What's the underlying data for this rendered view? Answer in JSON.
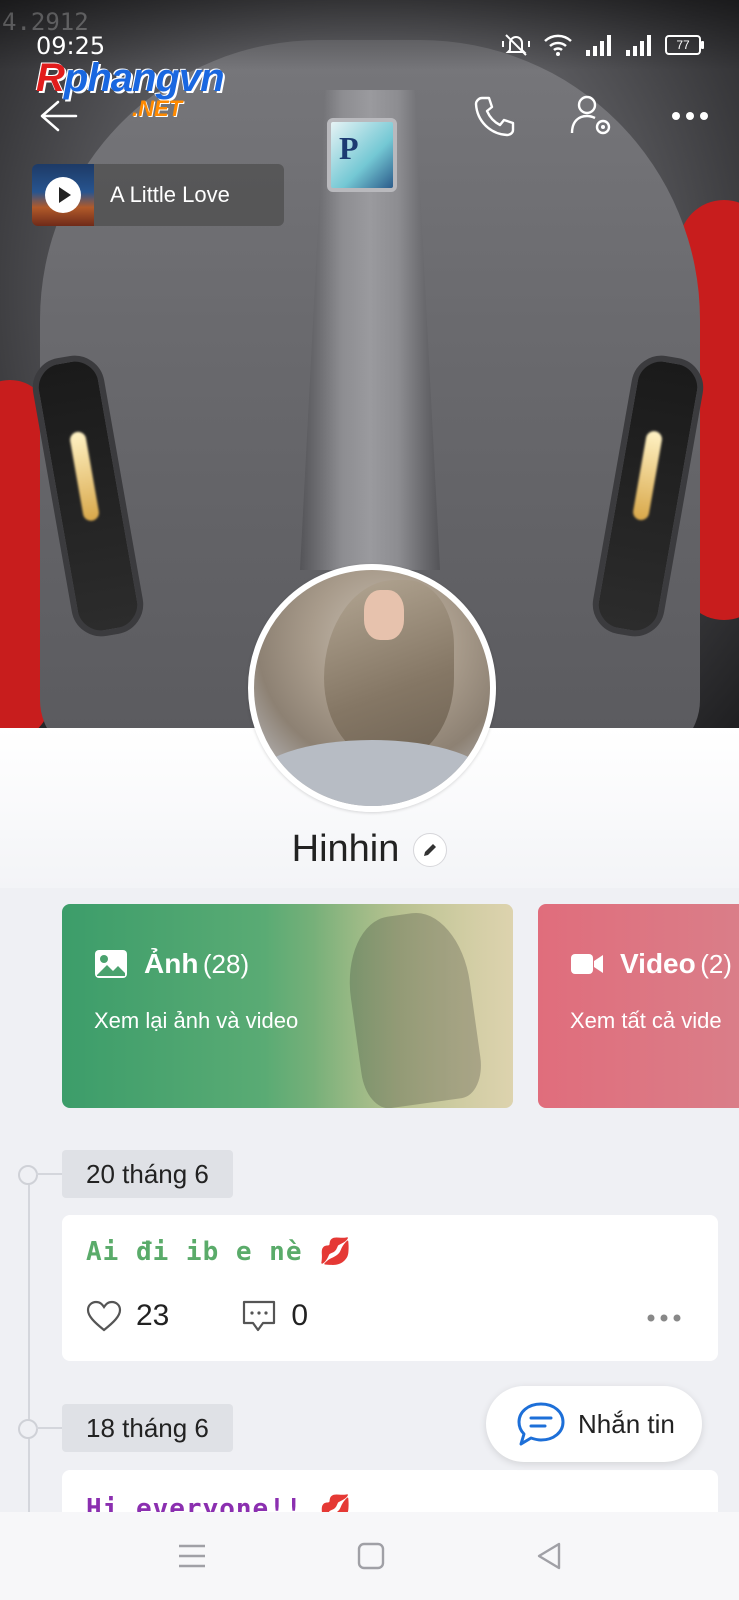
{
  "status_bar": {
    "time": "09:25",
    "watermark_number": "4.2912",
    "battery": "77"
  },
  "logo": {
    "main_prefix": "R",
    "main_rest": "phangvn",
    "suffix": ".NET"
  },
  "cover_badge": "P",
  "music": {
    "title": "A Little Love"
  },
  "profile": {
    "name": "Hinhin"
  },
  "media_cards": [
    {
      "label": "Ảnh",
      "count": "(28)",
      "subtitle": "Xem lại ảnh và video",
      "color": "#3c9d6a"
    },
    {
      "label": "Video",
      "count": "(2)",
      "subtitle": "Xem tất cả vide",
      "color": "#e06d7c"
    }
  ],
  "timeline": [
    {
      "date": "20 tháng 6",
      "text": "Ai đi ib e nè",
      "emoji": "💋",
      "text_color": "#5aab6a",
      "likes": "23",
      "comments": "0"
    },
    {
      "date": "18 tháng 6",
      "text": "Hi everyone!!",
      "emoji": "💋",
      "text_color": "#8b2fb0"
    }
  ],
  "chat_button": {
    "label": "Nhắn tin"
  },
  "icons": [
    "back-icon",
    "phone-icon",
    "user-settings-icon",
    "more-icon",
    "edit-icon",
    "image-icon",
    "video-camera-icon",
    "heart-icon",
    "comment-icon",
    "chat-bubble-icon",
    "menu-icon",
    "home-square-icon",
    "back-triangle-icon"
  ]
}
